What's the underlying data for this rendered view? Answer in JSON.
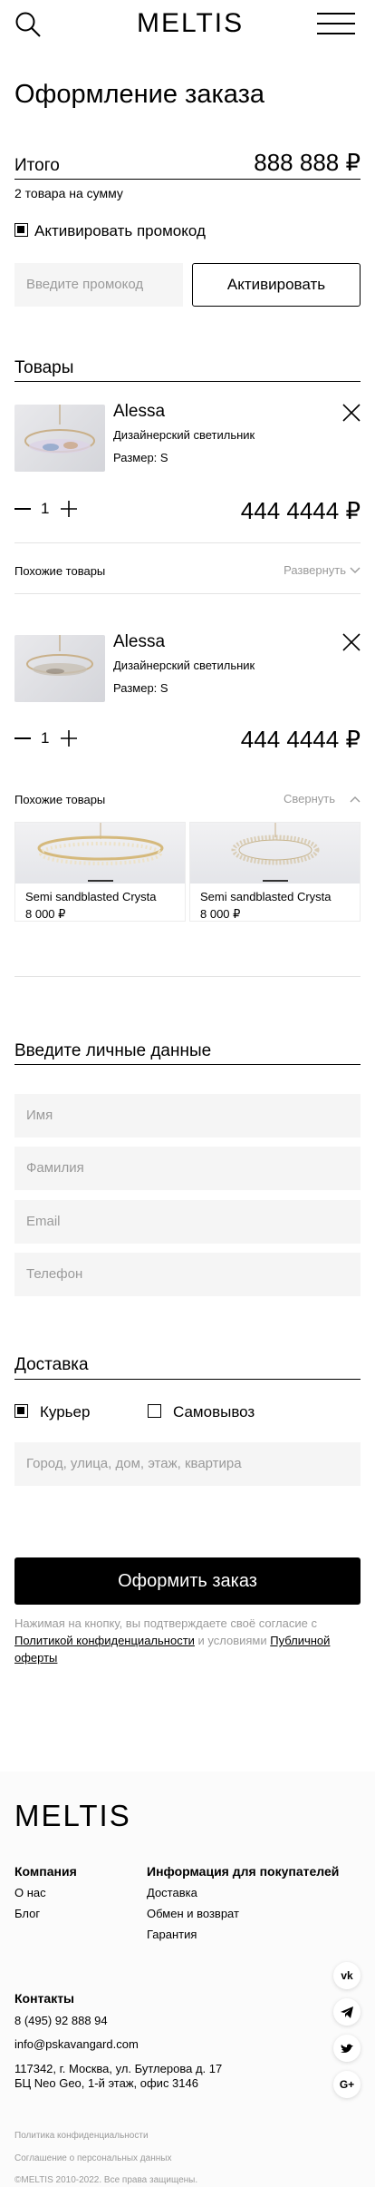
{
  "header": {
    "logo": "MELTIS"
  },
  "page_title": "Оформление заказа",
  "summary": {
    "total_label": "Итого",
    "total_value": "888 888 ₽",
    "items_count": "2 товара на сумму"
  },
  "promo": {
    "checkbox_label": "Активировать промокод",
    "checked": true,
    "input_placeholder": "Введите промокод",
    "button_label": "Активировать"
  },
  "goods": {
    "section_title": "Товары",
    "items": [
      {
        "name": "Alessa",
        "subtitle": "Дизайнерский светильник",
        "size": "Размер: S",
        "qty": "1",
        "price": "444 4444 ₽",
        "similar_label": "Похожие товары",
        "toggle_label": "Развернуть"
      },
      {
        "name": "Alessa",
        "subtitle": "Дизайнерский светильник",
        "size": "Размер: S",
        "qty": "1",
        "price": "444 4444 ₽",
        "similar_label": "Похожие товары",
        "toggle_label": "Свернуть"
      }
    ],
    "similar_cards": [
      {
        "name": "Semi sandblasted Crysta",
        "price": "8 000 ₽"
      },
      {
        "name": "Semi sandblasted Crysta",
        "price": "8 000 ₽"
      }
    ]
  },
  "personal": {
    "section_title": "Введите личные данные",
    "fields": {
      "name": "Имя",
      "surname": "Фамилия",
      "email": "Email",
      "phone": "Телефон"
    }
  },
  "delivery": {
    "section_title": "Доставка",
    "options": {
      "courier": "Курьер",
      "pickup": "Самовывоз"
    },
    "address_placeholder": "Город, улица, дом, этаж, квартира"
  },
  "submit": {
    "button_label": "Оформить заказ",
    "consent_prefix": "Нажимая на кнопку, вы подтверждаете своё согласие с",
    "privacy_link": "Политикой конфиденциальности",
    "consent_middle": "и условиями",
    "offer_link": "Публичной оферты"
  },
  "footer": {
    "logo": "MELTIS",
    "company_title": "Компания",
    "company_links": [
      "О нас",
      "Блог"
    ],
    "buyers_title": "Информация для покупателей",
    "buyers_links": [
      "Доставка",
      "Обмен и возврат",
      "Гарантия"
    ],
    "contacts_title": "Контакты",
    "phone": "8 (495) 92 888 94",
    "email": "info@pskavangard.com",
    "address_line1": "117342, г. Москва, ул. Бутлерова д. 17",
    "address_line2": "БЦ Neo Geo, 1-й этаж, офис 3146",
    "legal_links": [
      "Политика конфиденциальности",
      "Соглашение о персональных данных"
    ],
    "copyright": "©MELTIS 2010-2022. Все права защищены.",
    "socials": [
      "vk-icon",
      "telegram-icon",
      "twitter-icon",
      "google-plus-icon"
    ]
  }
}
